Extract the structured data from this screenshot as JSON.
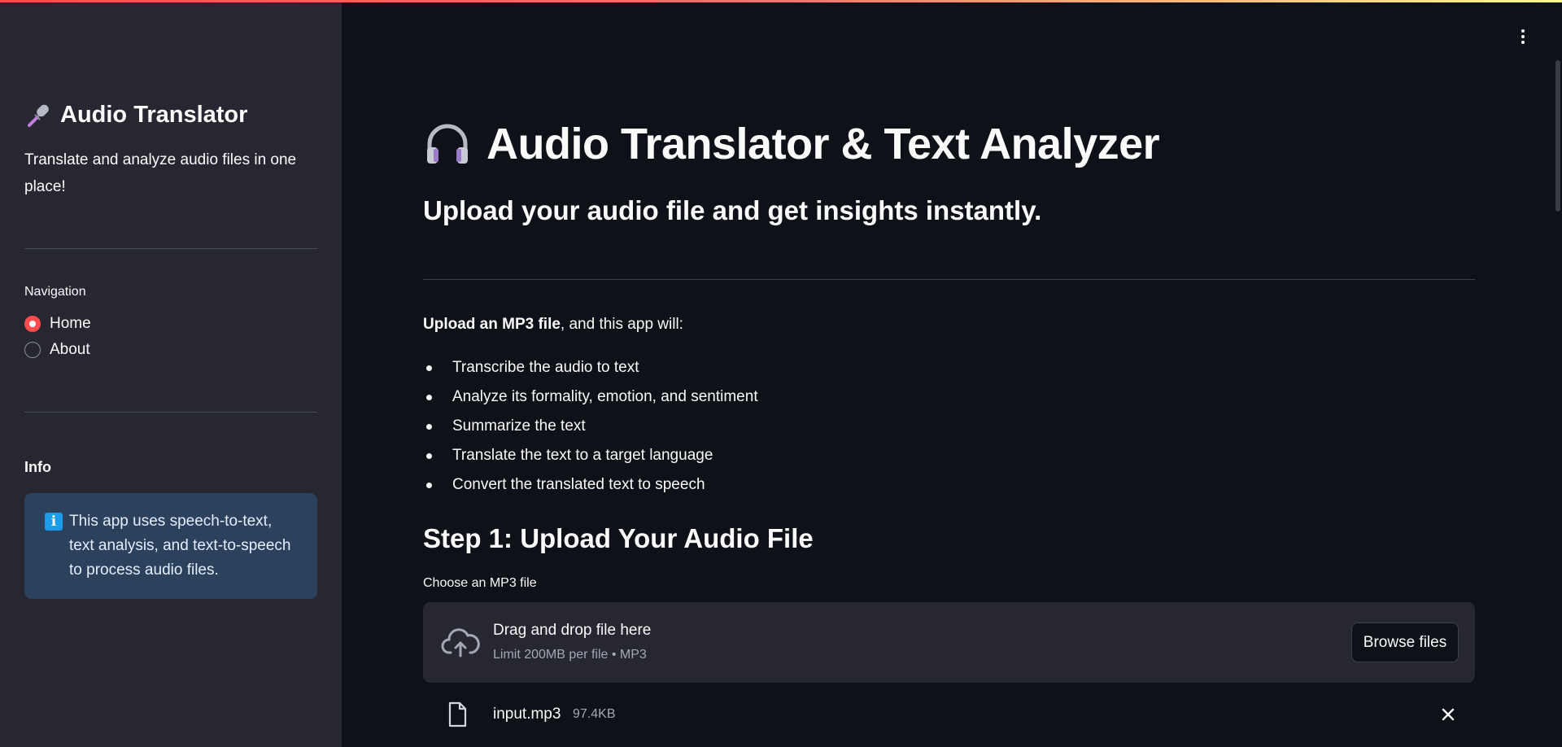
{
  "sidebar": {
    "title": "Audio Translator",
    "subtitle": "Translate and analyze audio files in one place!",
    "nav_label": "Navigation",
    "nav_options": [
      {
        "label": "Home",
        "selected": true
      },
      {
        "label": "About",
        "selected": false
      }
    ],
    "info_heading": "Info",
    "info_text": "This app uses speech-to-text, text analysis, and text-to-speech to process audio files."
  },
  "main": {
    "title": "Audio Translator & Text Analyzer",
    "subtitle": "Upload your audio file and get insights instantly.",
    "intro_bold": "Upload an MP3 file",
    "intro_rest": ", and this app will:",
    "features": [
      "Transcribe the audio to text",
      "Analyze its formality, emotion, and sentiment",
      "Summarize the text",
      "Translate the text to a target language",
      "Convert the translated text to speech"
    ],
    "step1_heading": "Step 1: Upload Your Audio File",
    "uploader": {
      "label": "Choose an MP3 file",
      "drop_title": "Drag and drop file here",
      "drop_limit": "Limit 200MB per file • MP3",
      "browse_label": "Browse files"
    },
    "uploaded_file": {
      "name": "input.mp3",
      "size": "97.4KB"
    }
  },
  "colors": {
    "background": "#0e1117",
    "sidebar": "#262730",
    "accent": "#ff4b4b",
    "info_bg": "#2b415c",
    "info_icon": "#1c9ce8"
  },
  "icons": {
    "sidebar_title": "microphone-icon",
    "main_title": "headphones-icon",
    "info": "info-icon",
    "upload": "cloud-upload-icon",
    "file": "file-icon",
    "remove": "close-icon",
    "menu": "kebab-menu-icon"
  }
}
